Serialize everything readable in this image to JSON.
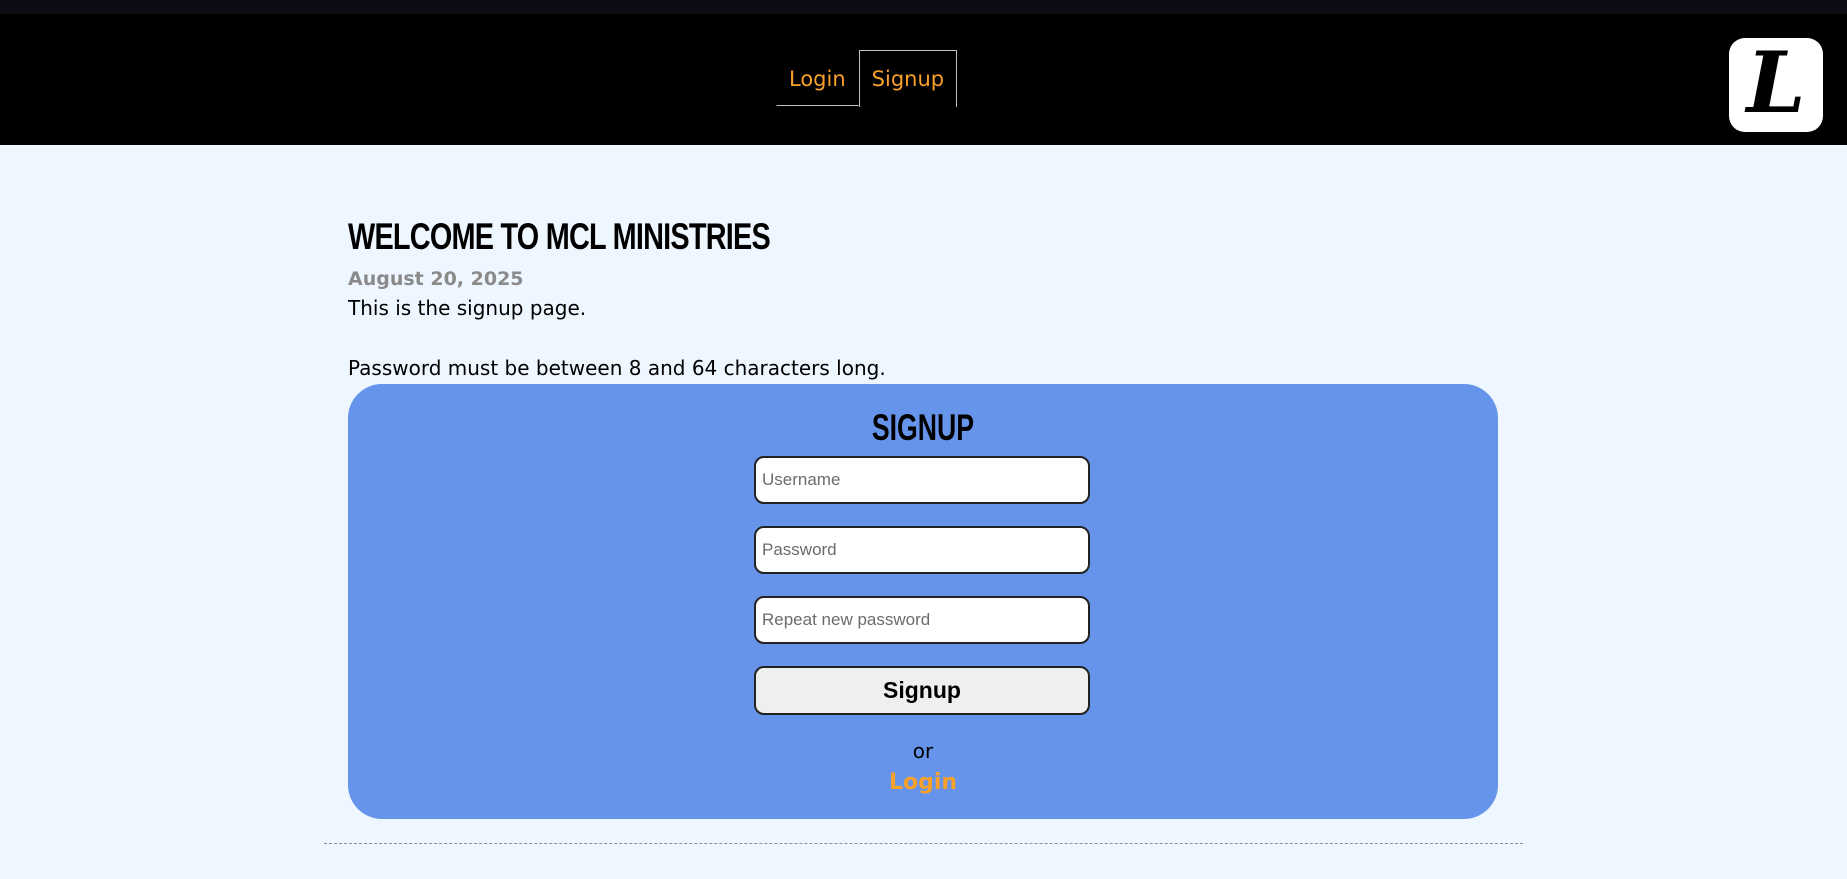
{
  "nav": {
    "items": [
      {
        "label": "Login",
        "active": false
      },
      {
        "label": "Signup",
        "active": true
      }
    ]
  },
  "logo": {
    "glyph": "L"
  },
  "page": {
    "title": "WELCOME TO MCL MINISTRIES",
    "date": "August 20, 2025",
    "intro": "This is the signup page.",
    "password_note": "Password must be between 8 and 64 characters long."
  },
  "form": {
    "title": "SIGNUP",
    "username_placeholder": "Username",
    "password_placeholder": "Password",
    "repeat_password_placeholder": "Repeat new password",
    "submit_label": "Signup",
    "or_text": "or",
    "login_link_label": "Login"
  },
  "colors": {
    "accent": "#f7a02a",
    "header_bg": "#000000",
    "page_bg": "#eef6ff",
    "card_bg": "#6694ea",
    "date_text": "#8a8a8a"
  }
}
